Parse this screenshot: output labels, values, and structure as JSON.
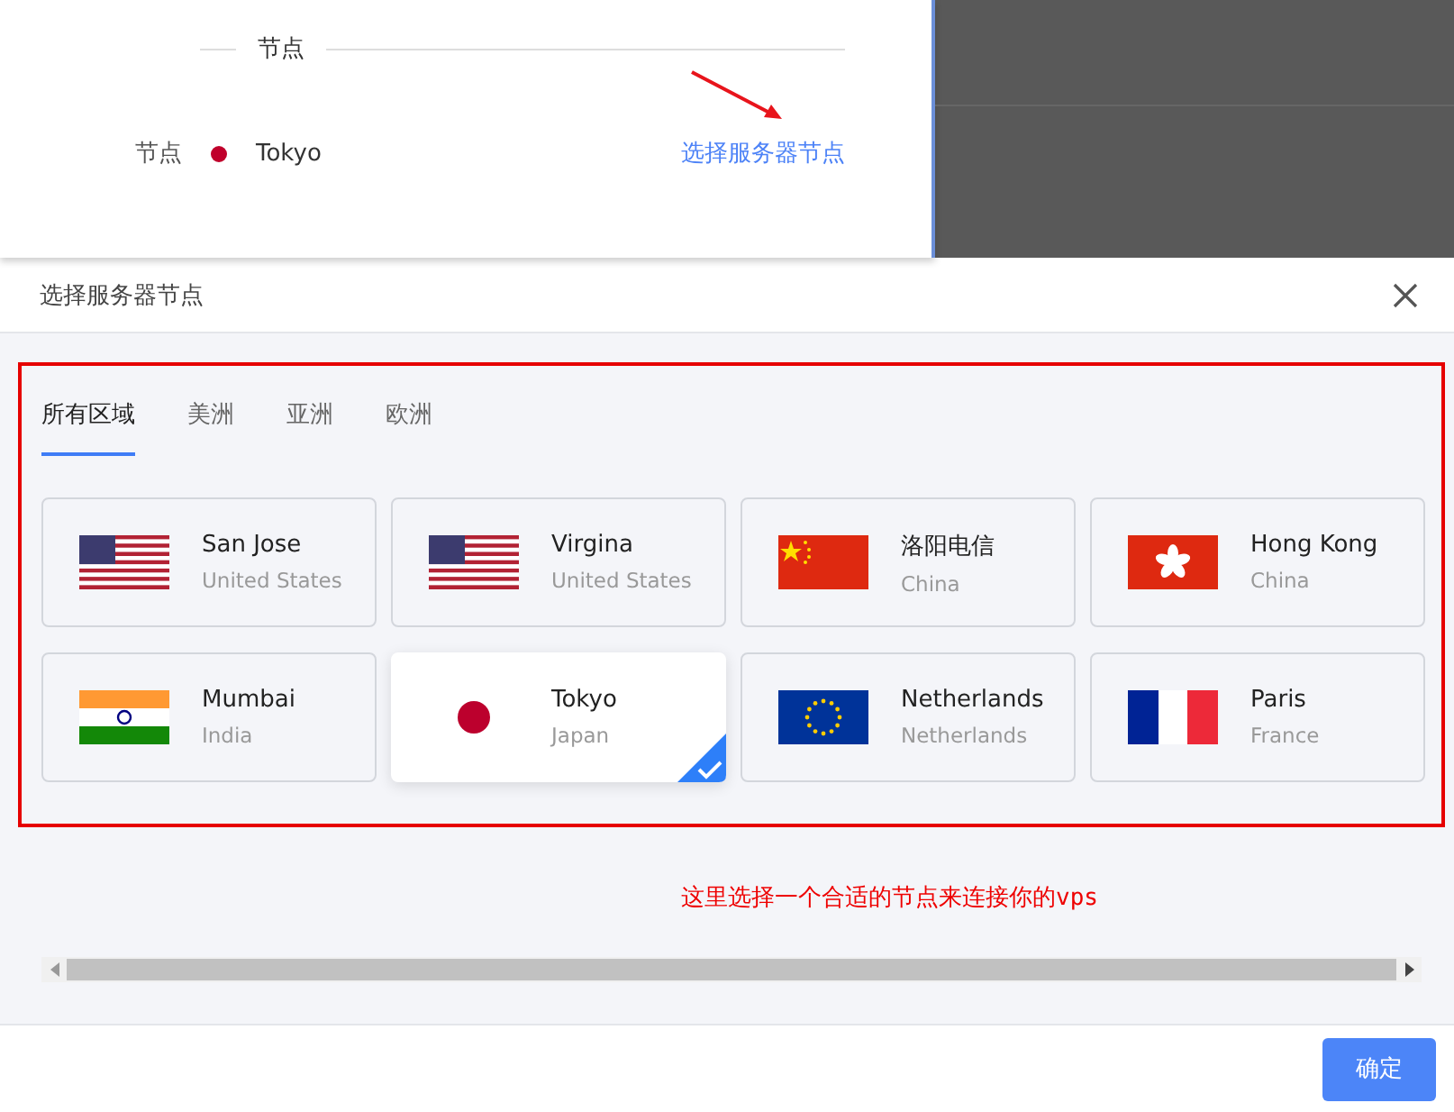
{
  "background_panel": {
    "section_title": "节点",
    "node_label": "节点",
    "node_value": "Tokyo",
    "select_link": "选择服务器节点"
  },
  "dialog": {
    "title": "选择服务器节点",
    "tabs": [
      {
        "label": "所有区域",
        "selected": true
      },
      {
        "label": "美洲",
        "selected": false
      },
      {
        "label": "亚洲",
        "selected": false
      },
      {
        "label": "欧洲",
        "selected": false
      }
    ],
    "nodes": [
      {
        "kind": "us",
        "name": "San Jose",
        "country": "United States",
        "selected": false
      },
      {
        "kind": "us",
        "name": "Virgina",
        "country": "United States",
        "selected": false
      },
      {
        "kind": "cn",
        "name": "洛阳电信",
        "country": "China",
        "selected": false
      },
      {
        "kind": "hk",
        "name": "Hong Kong",
        "country": "China",
        "selected": false
      },
      {
        "kind": "in",
        "name": "Mumbai",
        "country": "India",
        "selected": false
      },
      {
        "kind": "jp",
        "name": "Tokyo",
        "country": "Japan",
        "selected": true
      },
      {
        "kind": "eu",
        "name": "Netherlands",
        "country": "Netherlands",
        "selected": false
      },
      {
        "kind": "fr",
        "name": "Paris",
        "country": "France",
        "selected": false
      }
    ],
    "annotation": "这里选择一个合适的节点来连接你的vps",
    "confirm_button": "确定"
  }
}
